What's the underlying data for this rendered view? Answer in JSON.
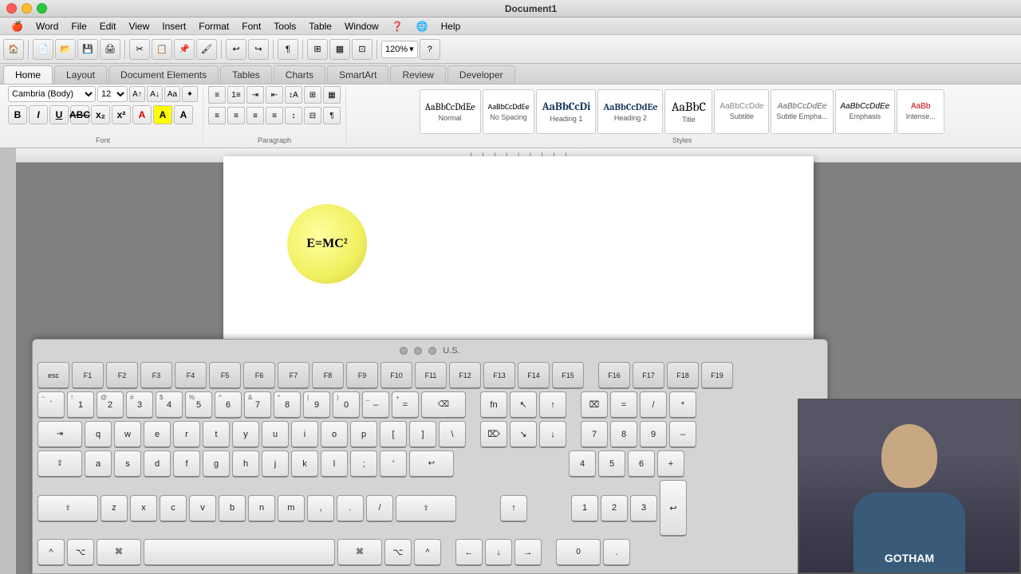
{
  "window": {
    "title": "Document1",
    "controls": {
      "close": "close",
      "minimize": "minimize",
      "maximize": "maximize"
    }
  },
  "menubar": {
    "apple": "🍎",
    "items": [
      "Word",
      "File",
      "Edit",
      "View",
      "Insert",
      "Format",
      "Font",
      "Tools",
      "Table",
      "Window",
      "Help"
    ]
  },
  "ribbon": {
    "tabs": [
      "Home",
      "Layout",
      "Document Elements",
      "Tables",
      "Charts",
      "SmartArt",
      "Review",
      "Developer"
    ],
    "active_tab": "Home",
    "sections": {
      "font": {
        "title": "Font",
        "font_family": "Cambria (Body)",
        "font_size": "12",
        "bold": "B",
        "italic": "I",
        "underline": "U",
        "strikethrough": "ABC",
        "subscript": "x₂",
        "superscript": "x²"
      },
      "paragraph": {
        "title": "Paragraph"
      },
      "styles": {
        "title": "Styles",
        "items": [
          {
            "name": "Normal",
            "preview": "AaBbCcDdEe"
          },
          {
            "name": "No Spacing",
            "preview": "AaBbCcDdEe"
          },
          {
            "name": "Heading 1",
            "preview": "AaBbCcDi"
          },
          {
            "name": "Heading 2",
            "preview": "AaBbCcDdEe"
          },
          {
            "name": "Title",
            "preview": "AaBbC"
          },
          {
            "name": "Subtitle",
            "preview": "AaBbCcDde"
          },
          {
            "name": "Subtle Empha...",
            "preview": "AaBbCcDdEe"
          },
          {
            "name": "Emphasis",
            "preview": "AaBbCcDdEe"
          },
          {
            "name": "Intense...",
            "preview": "AaBb"
          }
        ]
      }
    }
  },
  "toolbar": {
    "zoom": "120%"
  },
  "document": {
    "formula": "E=MC²",
    "cursor_visible": true
  },
  "keyboard": {
    "layout": "U.S.",
    "fn_row": [
      "esc",
      "F1",
      "F2",
      "F3",
      "F4",
      "F5",
      "F6",
      "F7",
      "F8",
      "F9",
      "F10",
      "F11",
      "F12",
      "F13",
      "F14",
      "F15",
      "F16",
      "F17",
      "F18",
      "F19"
    ],
    "row1": [
      "`",
      "1",
      "2",
      "3",
      "4",
      "5",
      "6",
      "7",
      "8",
      "9",
      "0",
      "-",
      "=",
      "⌫"
    ],
    "row2": [
      "⇥",
      "q",
      "w",
      "e",
      "r",
      "t",
      "y",
      "u",
      "i",
      "o",
      "p",
      "[",
      "]",
      "\\"
    ],
    "row3": [
      "⇪",
      "a",
      "s",
      "d",
      "f",
      "g",
      "h",
      "j",
      "k",
      "l",
      ";",
      "'",
      "↩"
    ],
    "row4": [
      "⇧",
      "z",
      "x",
      "c",
      "v",
      "b",
      "n",
      "m",
      ",",
      ".",
      "/",
      "⇧"
    ],
    "row5": [
      "^",
      "⌥",
      "⌘",
      "space",
      "⌘",
      "⌥",
      "^"
    ]
  },
  "webcam": {
    "visible": true
  }
}
